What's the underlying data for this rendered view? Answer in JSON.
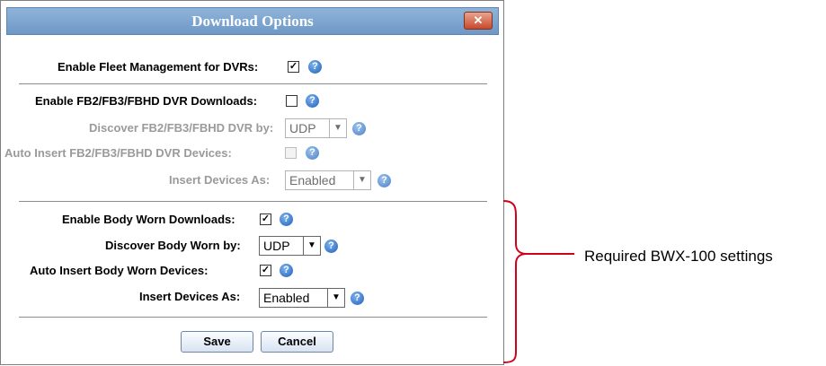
{
  "dialog": {
    "title": "Download Options",
    "close_glyph": "✕"
  },
  "fleet": {
    "label": "Enable Fleet Management for DVRs:",
    "checked": true
  },
  "fb": {
    "enable": {
      "label": "Enable FB2/FB3/FBHD DVR Downloads:",
      "checked": false
    },
    "discover": {
      "label": "Discover FB2/FB3/FBHD DVR by:",
      "value": "UDP"
    },
    "auto_insert": {
      "label": "Auto Insert FB2/FB3/FBHD DVR Devices:",
      "checked": false
    },
    "insert_as": {
      "label": "Insert Devices As:",
      "value": "Enabled"
    }
  },
  "bw": {
    "enable": {
      "label": "Enable Body Worn Downloads:",
      "checked": true
    },
    "discover": {
      "label": "Discover Body Worn by:",
      "value": "UDP"
    },
    "auto_insert": {
      "label": "Auto Insert Body Worn Devices:",
      "checked": true
    },
    "insert_as": {
      "label": "Insert Devices As:",
      "value": "Enabled"
    }
  },
  "buttons": {
    "save": "Save",
    "cancel": "Cancel"
  },
  "glyphs": {
    "check": "✓",
    "help": "?",
    "dropdown": "▼"
  },
  "annotation": {
    "text": "Required BWX-100 settings",
    "bracket_color": "#d0021b"
  }
}
